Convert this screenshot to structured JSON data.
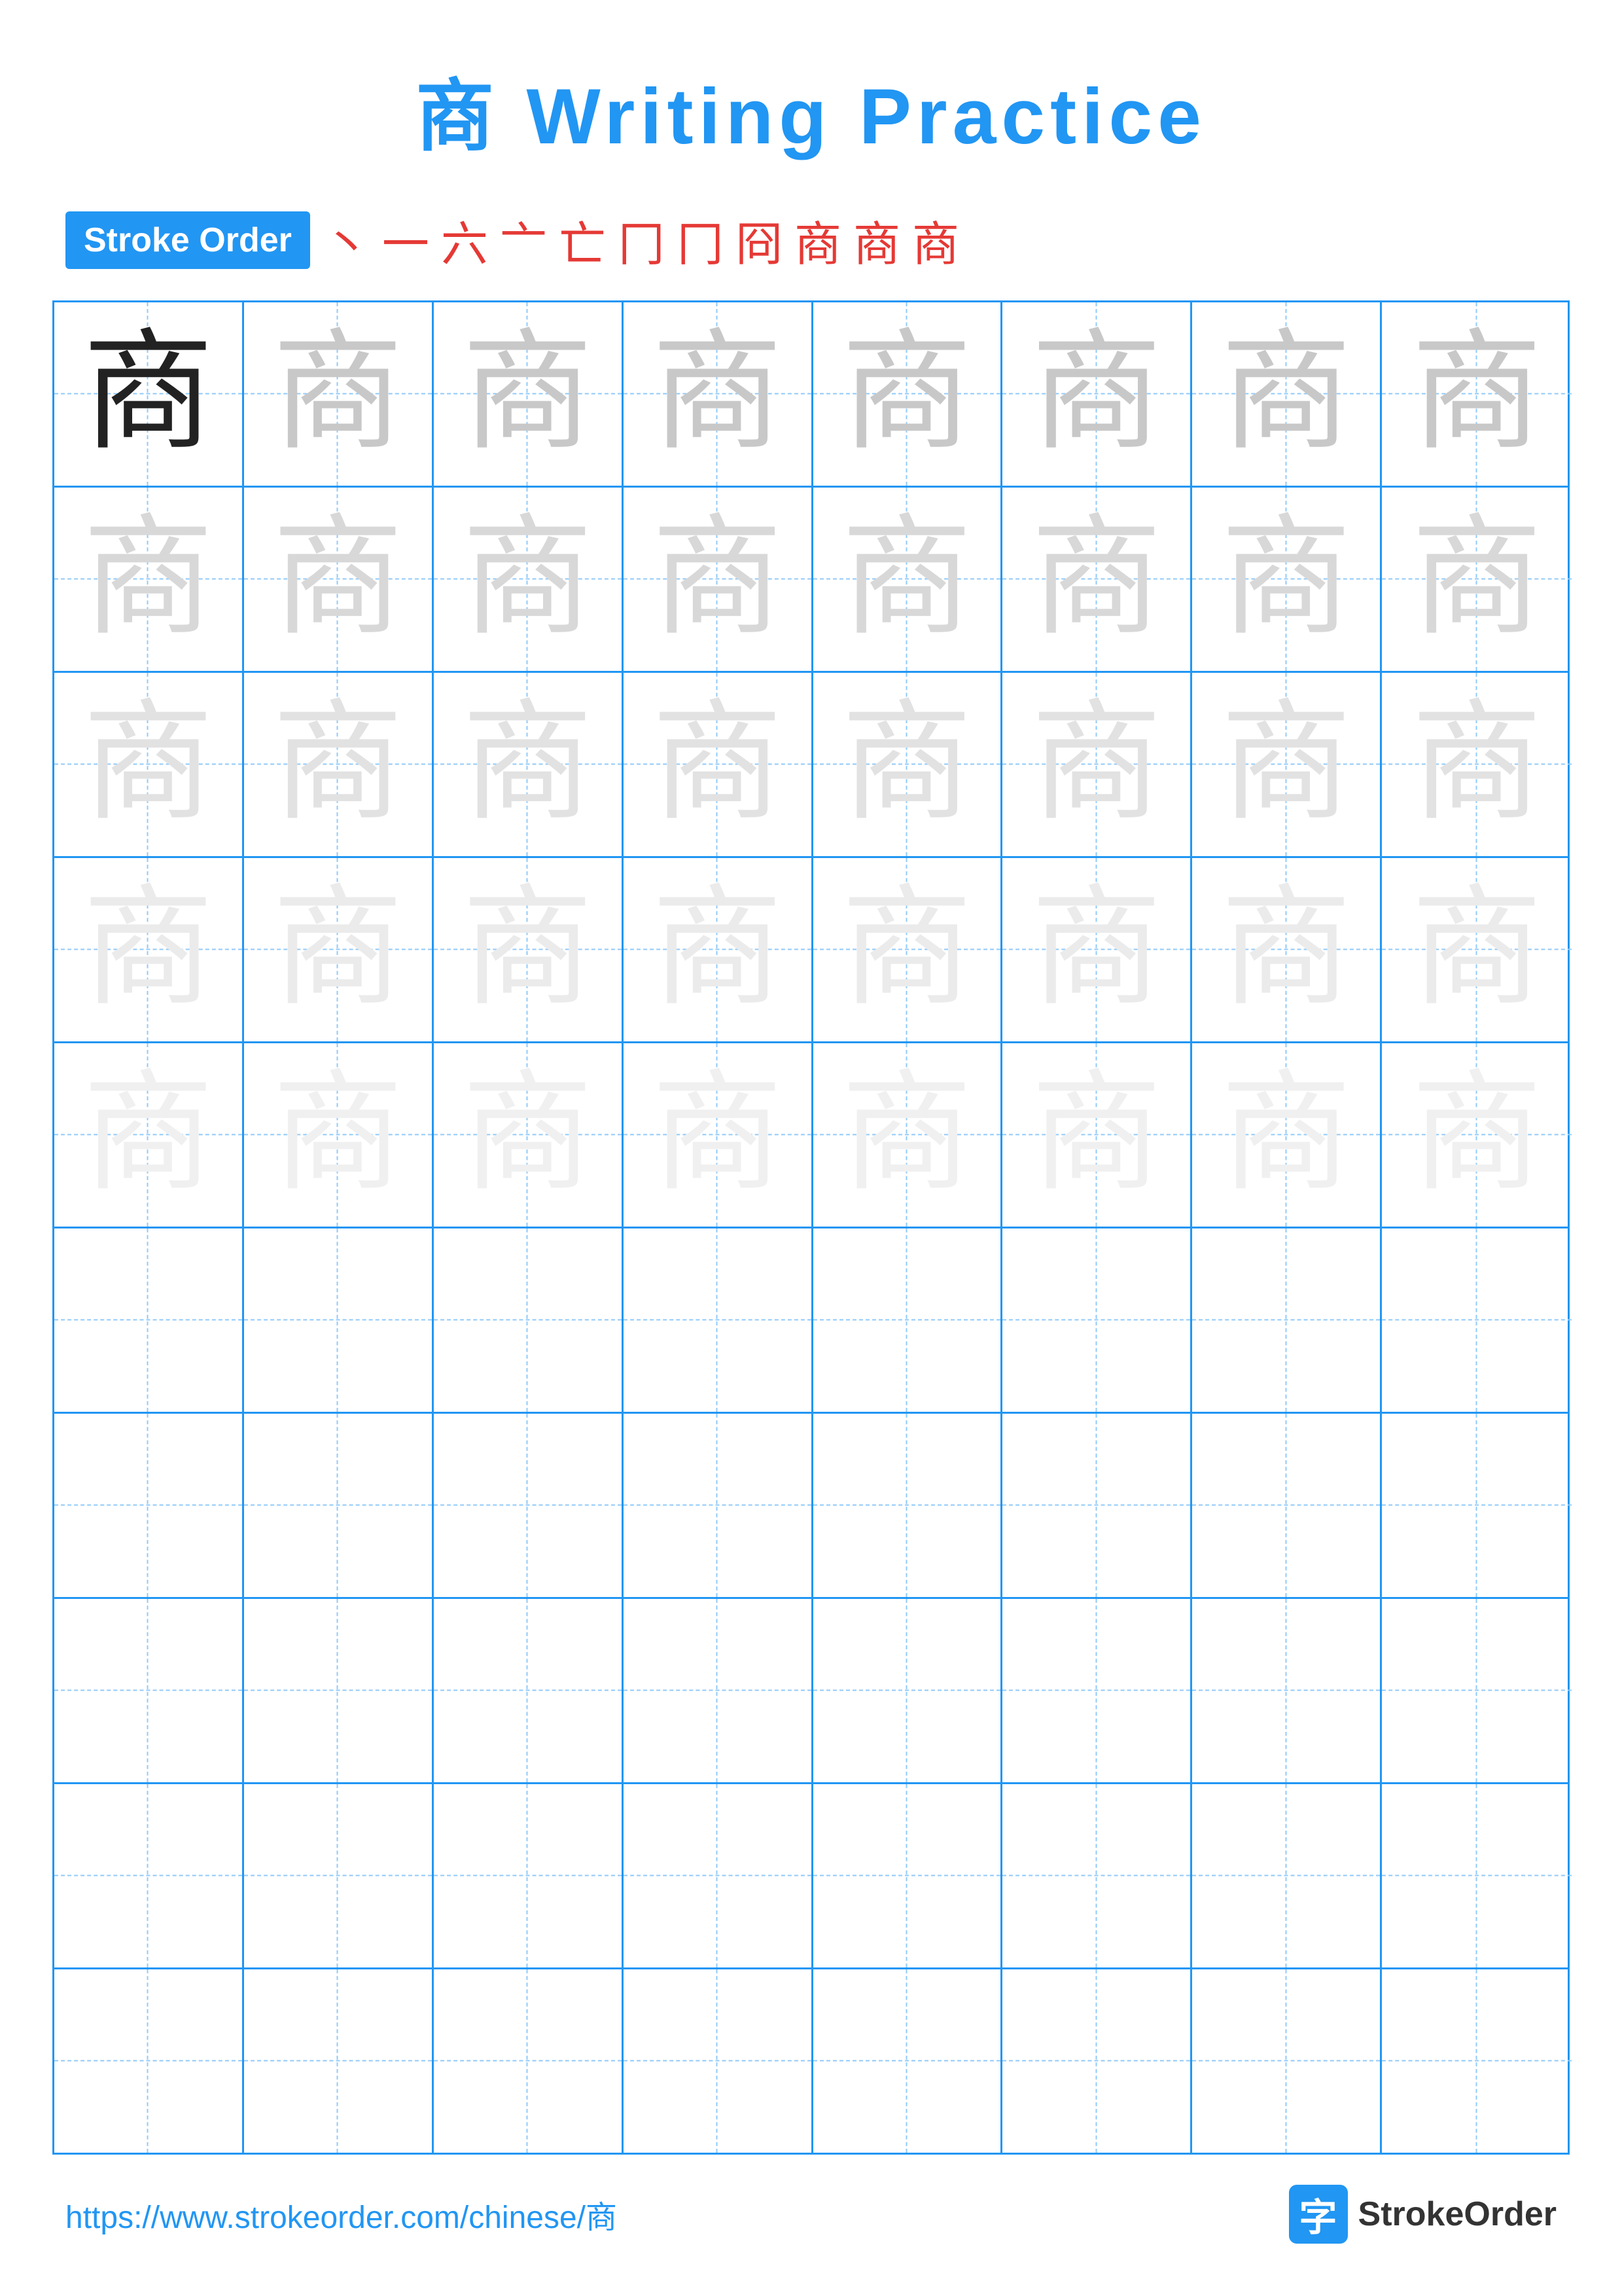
{
  "title": "商 Writing Practice",
  "stroke_order_label": "Stroke Order",
  "stroke_sequence": [
    "丶",
    "一",
    "六",
    "亠",
    "亡",
    "冂",
    "冂",
    "冏",
    "商",
    "商",
    "商"
  ],
  "character": "商",
  "footer_url": "https://www.strokeorder.com/chinese/商",
  "footer_brand": "StrokeOrder",
  "rows": [
    {
      "type": "solid_then_ghost1",
      "cells": 8
    },
    {
      "type": "ghost2",
      "cells": 8
    },
    {
      "type": "ghost3",
      "cells": 8
    },
    {
      "type": "ghost4",
      "cells": 8
    },
    {
      "type": "ghost5",
      "cells": 8
    },
    {
      "type": "empty",
      "cells": 8
    },
    {
      "type": "empty",
      "cells": 8
    },
    {
      "type": "empty",
      "cells": 8
    },
    {
      "type": "empty",
      "cells": 8
    },
    {
      "type": "empty",
      "cells": 8
    }
  ]
}
